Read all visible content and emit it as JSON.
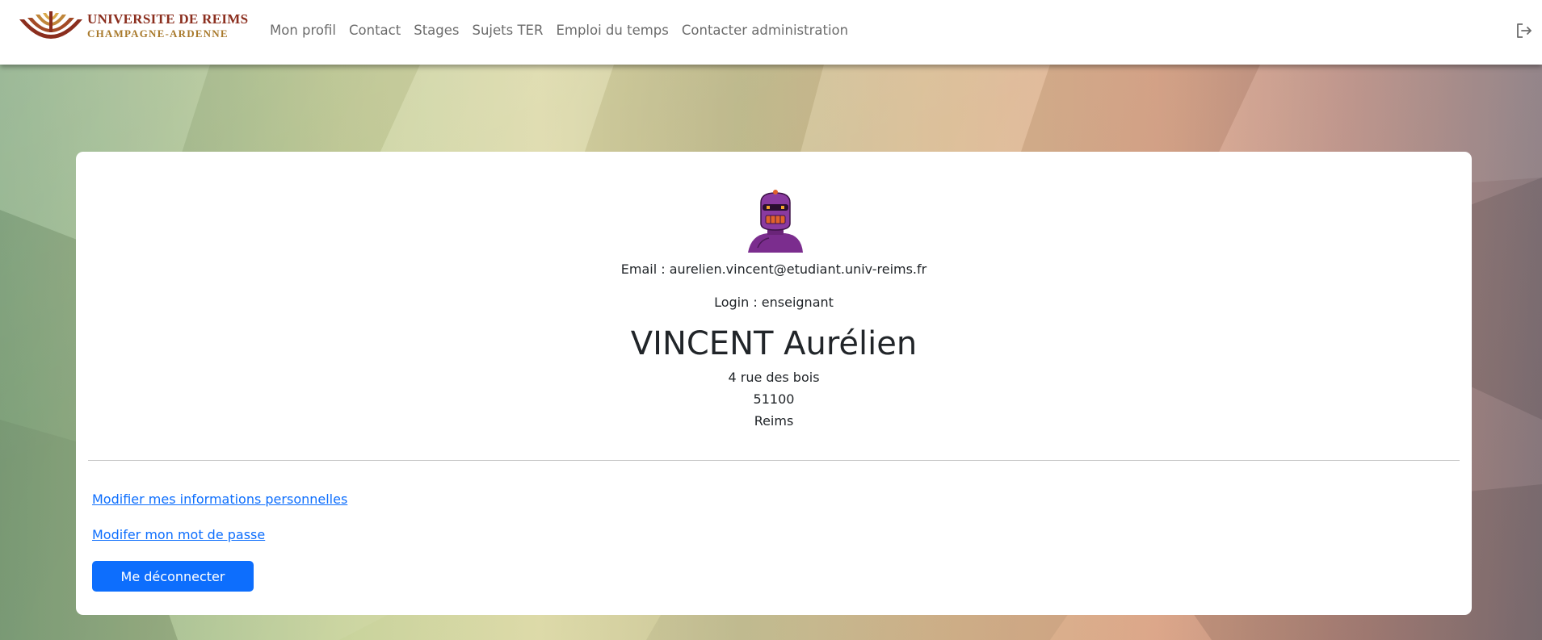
{
  "header": {
    "logo_line1": "UNIVERSITE DE REIMS",
    "logo_line2": "CHAMPAGNE-ARDENNE",
    "nav": [
      {
        "label": "Mon profil"
      },
      {
        "label": "Contact"
      },
      {
        "label": "Stages"
      },
      {
        "label": "Sujets TER"
      },
      {
        "label": "Emploi du temps"
      },
      {
        "label": "Contacter administration"
      }
    ],
    "logout_icon": "logout-icon"
  },
  "profile": {
    "avatar_icon": "robot-avatar",
    "email_line": "Email : aurelien.vincent@etudiant.univ-reims.fr",
    "login_line": "Login : enseignant",
    "full_name": "VINCENT Aurélien",
    "street": "4 rue des bois",
    "zip": "51100",
    "city": "Reims"
  },
  "actions": {
    "edit_info_link": "Modifier mes informations personnelles",
    "edit_password_link": "Modifer mon mot de passe",
    "logout_button": "Me déconnecter"
  },
  "colors": {
    "primary": "#0d6efd",
    "logo_red": "#8b2e1e",
    "logo_gold": "#a8792b",
    "avatar_purple": "#7b2d8e"
  }
}
